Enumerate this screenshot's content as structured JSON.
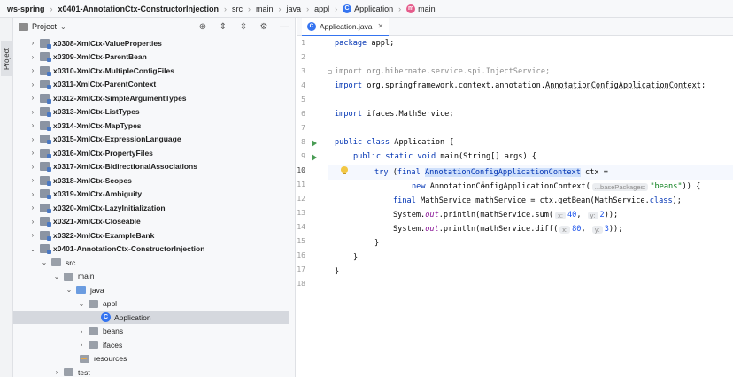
{
  "breadcrumb": {
    "project": "ws-spring",
    "module": "x0401-AnnotationCtx-ConstructorInjection",
    "path": [
      "src",
      "main",
      "java",
      "appl"
    ],
    "class_name": "Application",
    "member": "main"
  },
  "stripe": {
    "label": "Project"
  },
  "project_panel": {
    "title": "Project",
    "tree": [
      {
        "label": "x0308-XmlCtx-ValueProperties",
        "type": "module",
        "expanded": false
      },
      {
        "label": "x0309-XmlCtx-ParentBean",
        "type": "module",
        "expanded": false
      },
      {
        "label": "x0310-XmlCtx-MultipleConfigFiles",
        "type": "module",
        "expanded": false
      },
      {
        "label": "x0311-XmlCtx-ParentContext",
        "type": "module",
        "expanded": false
      },
      {
        "label": "x0312-XmlCtx-SimpleArgumentTypes",
        "type": "module",
        "expanded": false
      },
      {
        "label": "x0313-XmlCtx-ListTypes",
        "type": "module",
        "expanded": false
      },
      {
        "label": "x0314-XmlCtx-MapTypes",
        "type": "module",
        "expanded": false
      },
      {
        "label": "x0315-XmlCtx-ExpressionLanguage",
        "type": "module",
        "expanded": false
      },
      {
        "label": "x0316-XmlCtx-PropertyFiles",
        "type": "module",
        "expanded": false
      },
      {
        "label": "x0317-XmlCtx-BidirectionalAssociations",
        "type": "module",
        "expanded": false
      },
      {
        "label": "x0318-XmlCtx-Scopes",
        "type": "module",
        "expanded": false
      },
      {
        "label": "x0319-XmlCtx-Ambiguity",
        "type": "module",
        "expanded": false
      },
      {
        "label": "x0320-XmlCtx-LazyInitialization",
        "type": "module",
        "expanded": false
      },
      {
        "label": "x0321-XmlCtx-Closeable",
        "type": "module",
        "expanded": false
      },
      {
        "label": "x0322-XmlCtx-ExampleBank",
        "type": "module",
        "expanded": false
      },
      {
        "label": "x0401-AnnotationCtx-ConstructorInjection",
        "type": "module",
        "expanded": true
      },
      {
        "label": "src",
        "type": "folder",
        "expanded": true
      },
      {
        "label": "main",
        "type": "folder",
        "expanded": true
      },
      {
        "label": "java",
        "type": "folder-blue",
        "expanded": true
      },
      {
        "label": "appl",
        "type": "folder",
        "expanded": true
      },
      {
        "label": "Application",
        "type": "class",
        "selected": true
      },
      {
        "label": "beans",
        "type": "folder",
        "expanded": false
      },
      {
        "label": "ifaces",
        "type": "folder",
        "expanded": false
      },
      {
        "label": "resources",
        "type": "folder-res"
      },
      {
        "label": "test",
        "type": "folder",
        "expanded": false
      }
    ]
  },
  "editor": {
    "tab_label": "Application.java",
    "line_numbers": [
      "1",
      "2",
      "3",
      "4",
      "5",
      "6",
      "7",
      "8",
      "9",
      "10",
      "11",
      "12",
      "13",
      "14",
      "15",
      "16",
      "17",
      "18"
    ],
    "current_line": "10",
    "code": {
      "l1_kw": "package",
      "l1_rest": " appl;",
      "l3": "import org.hibernate.service.spi.InjectService;",
      "l4_kw": "import",
      "l4_rest": " org.springframework.context.annotation.",
      "l4_cls": "AnnotationConfigApplicationContext",
      "l4_end": ";",
      "l6_kw": "import",
      "l6_rest": " ifaces.MathService;",
      "l8_kw": "public class",
      "l8_rest": " Application {",
      "l9_kw": "public static void",
      "l9_rest": " main(String[] args) {",
      "l10_kw": "try",
      "l10_a": " (",
      "l10_final": "final",
      "l10_sp": " ",
      "l10_hl": "AnnotationConfigApplicationContext",
      "l10_rest": " ctx =",
      "l11_kw": "new",
      "l11_rest": " AnnotationConfigApplicationContext(",
      "l11_hint": "...basePackages:",
      "l11_str": "\"beans\"",
      "l11_end": ")) {",
      "l12_kw": "final",
      "l12_rest": " MathService mathService = ctx.getBean(MathService.",
      "l12_cls": "class",
      "l12_end": ");",
      "l13_a": "System.",
      "l13_out": "out",
      "l13_b": ".println(mathService.sum(",
      "l13_hx": "x:",
      "l13_vx": "40",
      "l13_c": ", ",
      "l13_hy": "y:",
      "l13_vy": "2",
      "l13_end": "));",
      "l14_a": "System.",
      "l14_out": "out",
      "l14_b": ".println(mathService.diff(",
      "l14_hx": "x:",
      "l14_vx": "80",
      "l14_c": ", ",
      "l14_hy": "y:",
      "l14_vy": "3",
      "l14_end": "));",
      "l15": "}",
      "l16": "}",
      "l17": "}"
    }
  }
}
